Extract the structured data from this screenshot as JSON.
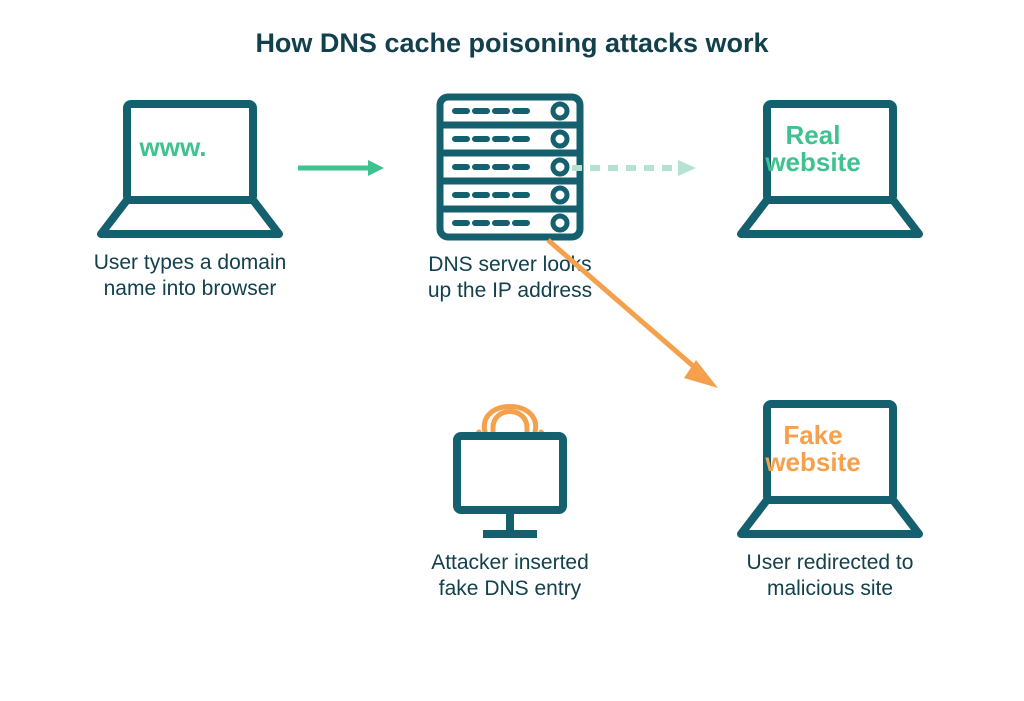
{
  "title": "How DNS cache poisoning attacks work",
  "nodes": {
    "user": {
      "screen_text": "www.",
      "caption": "User types a domain\nname into browser"
    },
    "server": {
      "caption": "DNS server looks\nup the IP address"
    },
    "real_site": {
      "screen_text": "Real\nwebsite",
      "caption": ""
    },
    "attacker": {
      "caption": "Attacker inserted\nfake DNS entry"
    },
    "fake_site": {
      "screen_text": "Fake\nwebsite",
      "caption": "User redirected to\nmalicious site"
    }
  },
  "colors": {
    "teal": "#15606f",
    "green": "#3ec28f",
    "green_light": "#b6e2d1",
    "orange": "#f5a04c"
  }
}
